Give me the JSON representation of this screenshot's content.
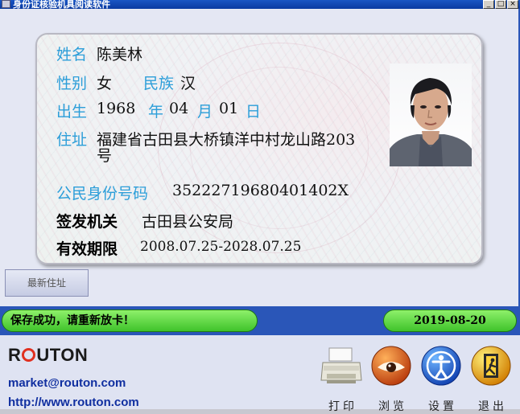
{
  "window": {
    "title": "身份证核验机具阅读软件",
    "minimize": "_",
    "maximize": "□",
    "close": "×"
  },
  "card": {
    "name_label": "姓名",
    "name_value": "陈美林",
    "sex_label": "性别",
    "sex_value": "女",
    "ethnicity_label": "民族",
    "ethnicity_value": "汉",
    "birth_label": "出生",
    "birth_year": "1968",
    "year_unit": "年",
    "birth_month": "04",
    "month_unit": "月",
    "birth_day": "01",
    "day_unit": "日",
    "address_label": "住址",
    "address_line1": "福建省古田县大桥镇洋中村龙山路203",
    "address_line2": "号",
    "id_label": "公民身份号码",
    "id_value": "35222719680401402X",
    "authority_label": "签发机关",
    "authority_value": "古田县公安局",
    "validity_label": "有效期限",
    "validity_value": "2008.07.25-2028.07.25"
  },
  "latest_address_button": "最新住址",
  "status_message": "保存成功，请重新放卡！",
  "date": "2019-08-20",
  "brand": {
    "logo": "ROUTON",
    "email": "market@routon.com",
    "url": "http://www.routon.com"
  },
  "toolbar": [
    {
      "label": "打印",
      "icon": "printer-icon"
    },
    {
      "label": "浏览",
      "icon": "eye-icon"
    },
    {
      "label": "设置",
      "icon": "person-settings-icon"
    },
    {
      "label": "退出",
      "icon": "exit-icon"
    }
  ],
  "colors": {
    "label_blue": "#2c9ed9",
    "frame_blue": "#2a56b8",
    "status_green": "#3fc32b",
    "link_blue": "#102fa0"
  }
}
